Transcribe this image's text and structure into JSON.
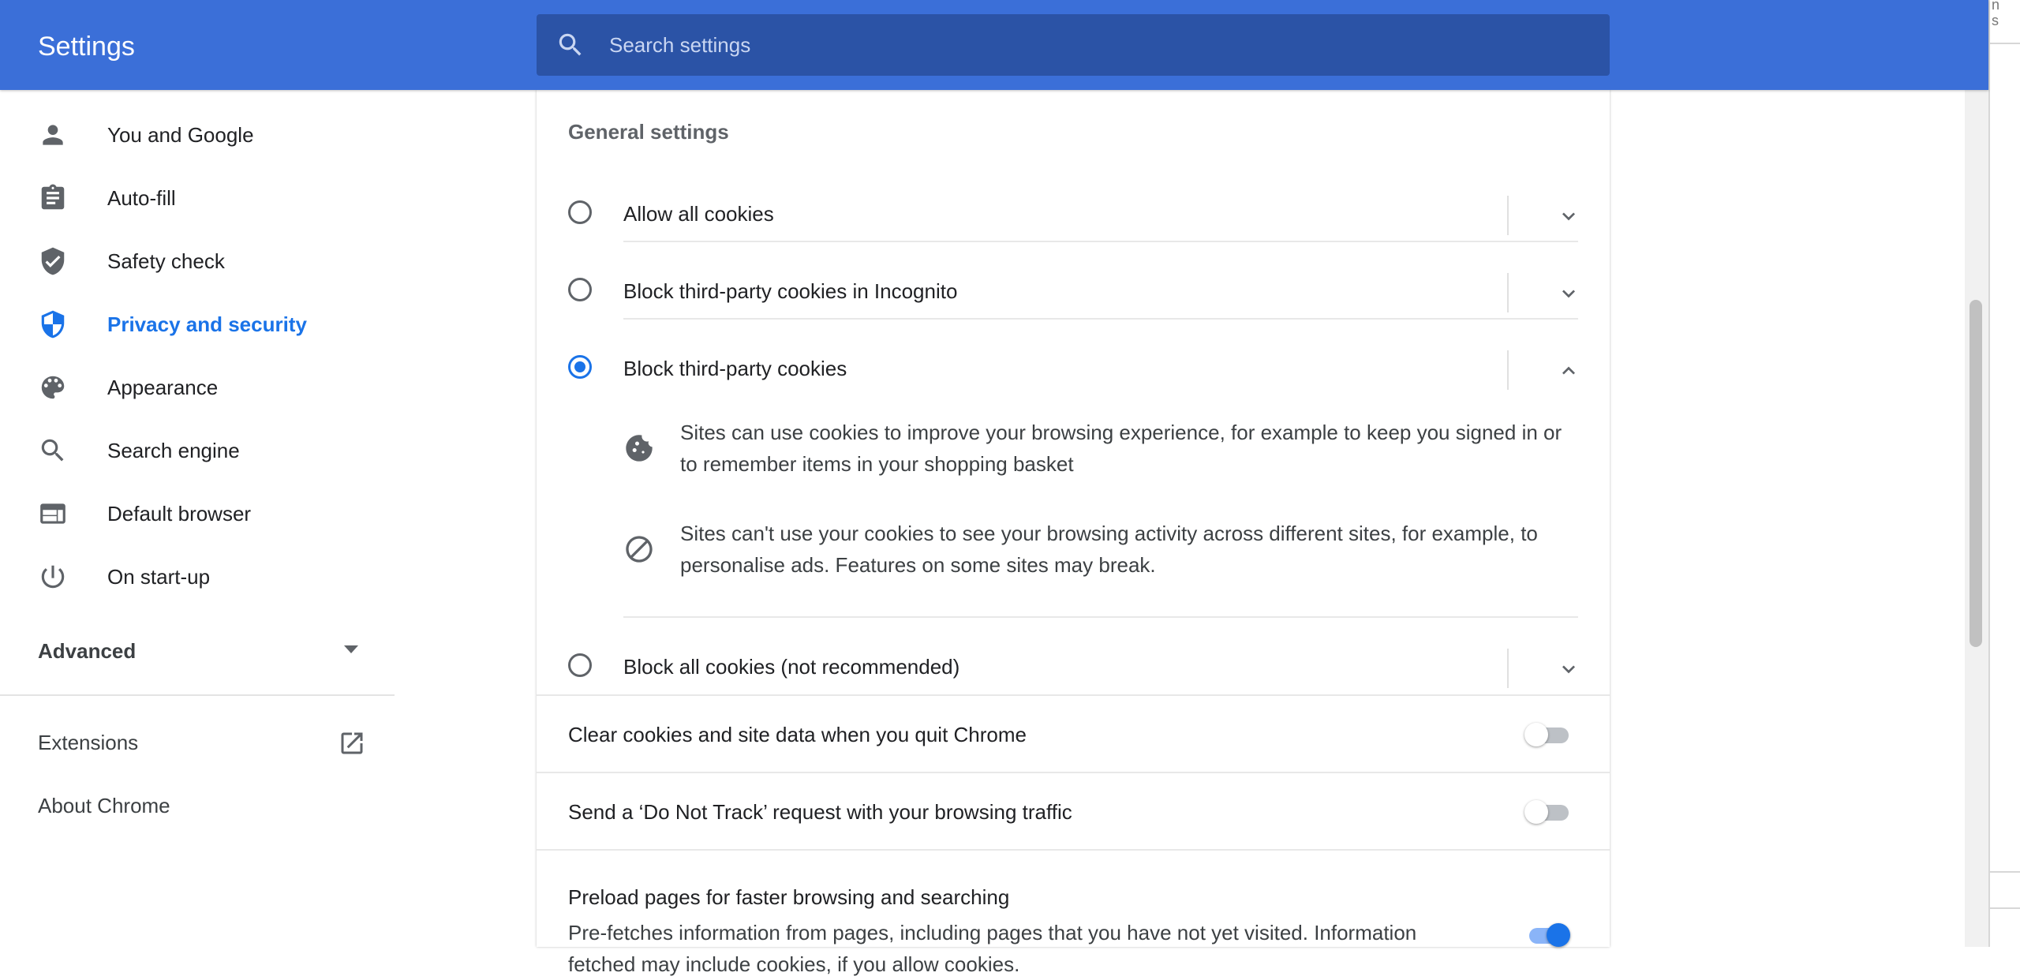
{
  "header": {
    "title": "Settings",
    "search_placeholder": "Search settings"
  },
  "sidebar": {
    "items": [
      {
        "label": "You and Google",
        "icon": "person-icon"
      },
      {
        "label": "Auto-fill",
        "icon": "clipboard-icon"
      },
      {
        "label": "Safety check",
        "icon": "shield-check-icon"
      },
      {
        "label": "Privacy and security",
        "icon": "shield-half-icon",
        "active": true
      },
      {
        "label": "Appearance",
        "icon": "palette-icon"
      },
      {
        "label": "Search engine",
        "icon": "search-icon"
      },
      {
        "label": "Default browser",
        "icon": "browser-window-icon"
      },
      {
        "label": "On start-up",
        "icon": "power-icon"
      }
    ],
    "advanced_label": "Advanced",
    "extensions_label": "Extensions",
    "about_label": "About Chrome"
  },
  "main": {
    "section_title": "General settings",
    "cookie_options": [
      {
        "label": "Allow all cookies",
        "checked": false,
        "expanded": false
      },
      {
        "label": "Block third-party cookies in Incognito",
        "checked": false,
        "expanded": false
      },
      {
        "label": "Block third-party cookies",
        "checked": true,
        "expanded": true
      },
      {
        "label": "Block all cookies (not recommended)",
        "checked": false,
        "expanded": false
      }
    ],
    "details": [
      {
        "icon": "cookie-icon",
        "text": "Sites can use cookies to improve your browsing experience, for example to keep you signed in or to remember items in your shopping basket"
      },
      {
        "icon": "block-icon",
        "text": "Sites can't use your cookies to see your browsing activity across different sites, for example, to personalise ads. Features on some sites may break."
      }
    ],
    "toggles": [
      {
        "label": "Clear cookies and site data when you quit Chrome",
        "on": false
      },
      {
        "label": "Send a ‘Do Not Track’ request with your browsing traffic",
        "on": false
      }
    ],
    "preload": {
      "label": "Preload pages for faster browsing and searching",
      "description": "Pre-fetches information from pages, including pages that you have not yet visited. Information fetched may include cookies, if you allow cookies.",
      "on": true
    }
  },
  "outer_window": {
    "text_line1": "n",
    "text_line2": "s"
  },
  "colors": {
    "header": "#3b6fd8",
    "search_box": "#2b53a6",
    "accent": "#1a73e8"
  }
}
